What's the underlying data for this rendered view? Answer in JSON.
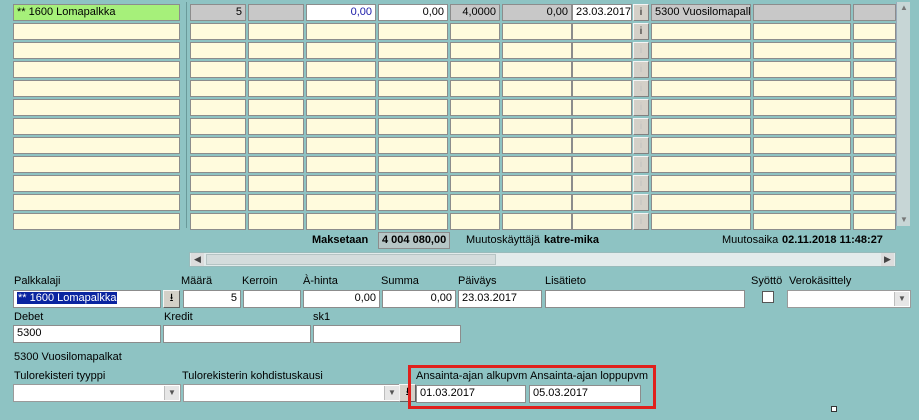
{
  "grid": {
    "row1": {
      "palkkalaji": "** 1600 Lomapalkka",
      "maara": "5",
      "kerroin": "",
      "ahinta": "0,00",
      "summa": "0,00",
      "col6": "4,0000",
      "col7": "0,00",
      "paivays": "23.03.2017",
      "info_button": "i",
      "tili": "5300 Vuosilomapalk"
    },
    "empty_info_button": "i"
  },
  "summary": {
    "maksetaan_label": "Maksetaan",
    "maksetaan_value": "4 004 080,00",
    "muutoskayttaja_label": "Muutoskäyttäjä",
    "muutoskayttaja_value": "katre-mika",
    "muutosaika_label": "Muutosaika",
    "muutosaika_value": "02.11.2018 11:48:27"
  },
  "form": {
    "labels": {
      "palkkalaji": "Palkkalaji",
      "maara": "Määrä",
      "kerroin": "Kerroin",
      "ahinta": "À-hinta",
      "summa": "Summa",
      "paivays": "Päiväys",
      "lisatieto": "Lisätieto",
      "syotto": "Syöttö",
      "verokasittely": "Verokäsittely",
      "debet": "Debet",
      "kredit": "Kredit",
      "sk1": "sk1",
      "tulorekisteri_tyyppi": "Tulorekisteri tyyppi",
      "tulorekisterin_kohdistuskausi": "Tulorekisterin kohdistuskausi",
      "ansainta_alku": "Ansainta-ajan alkupvm",
      "ansainta_loppu": "Ansainta-ajan loppupvm"
    },
    "values": {
      "palkkalaji": "** 1600 Lomapalkka",
      "maara": "5",
      "kerroin": "",
      "ahinta": "0,00",
      "summa": "0,00",
      "paivays": "23.03.2017",
      "lisatieto": "",
      "debet": "5300",
      "kredit": "",
      "sk1": "",
      "debet_description": "5300 Vuosilomapalkat",
      "ansainta_alku": "01.03.2017",
      "ansainta_loppu": "05.03.2017"
    },
    "highlight_color": "#e0201c"
  }
}
